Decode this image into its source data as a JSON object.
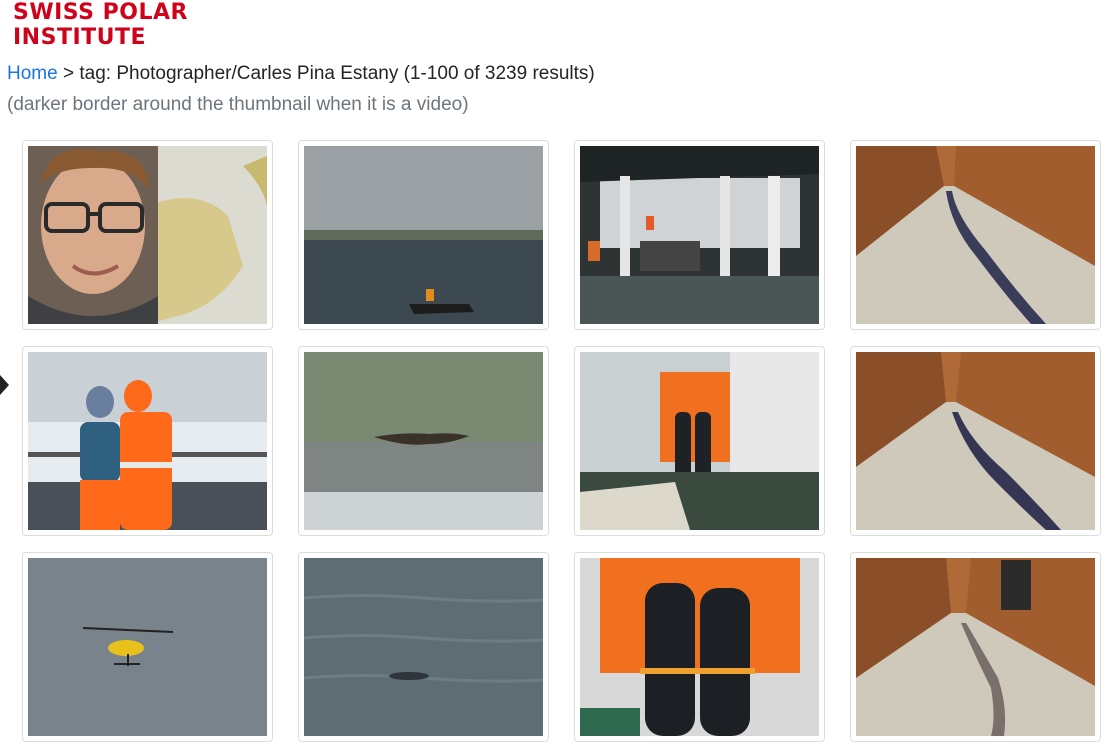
{
  "logo": {
    "line1": "SWISS POLAR",
    "line2": "INSTITUTE"
  },
  "breadcrumb": {
    "home_label": "Home",
    "separator": ">",
    "tag_text": "tag: Photographer/Carles Pina Estany (1-100 of 3239 results)"
  },
  "note": "(darker border around the thumbnail when it is a video)",
  "thumbnails": [
    {
      "subject": "portrait-man-glasses-map"
    },
    {
      "subject": "zodiac-boat-grey-sea"
    },
    {
      "subject": "ship-deck-wet"
    },
    {
      "subject": "corridor-hose"
    },
    {
      "subject": "two-people-orange-suits-ice"
    },
    {
      "subject": "bird-flying-over-sea"
    },
    {
      "subject": "gas-cylinders-orange-crane"
    },
    {
      "subject": "corridor-hose-2"
    },
    {
      "subject": "yellow-helicopter-sky"
    },
    {
      "subject": "sea-surface-animal"
    },
    {
      "subject": "gas-cylinders-closeup"
    },
    {
      "subject": "corridor-hose-3"
    }
  ]
}
